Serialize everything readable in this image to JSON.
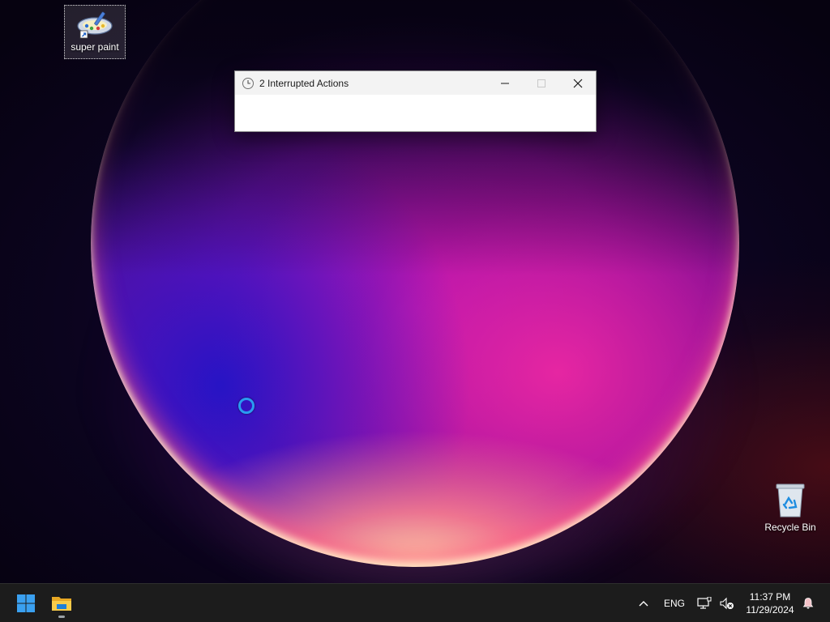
{
  "desktop": {
    "icons": [
      {
        "label": "super paint",
        "icon": "super-paint-icon",
        "selected": true
      },
      {
        "label": "Recycle Bin",
        "icon": "recycle-bin-icon",
        "selected": false
      }
    ]
  },
  "window": {
    "title": "2 Interrupted Actions",
    "icon": "clock-icon",
    "controls": {
      "minimize": "minimize-icon",
      "maximize": "maximize-icon",
      "close": "close-icon"
    }
  },
  "cursor": {
    "state": "busy"
  },
  "taskbar": {
    "pinned": [
      {
        "name": "start",
        "icon": "windows-logo-icon"
      },
      {
        "name": "file-explorer",
        "icon": "folder-icon",
        "running": true
      }
    ],
    "tray": {
      "overflow_icon": "chevron-up-icon",
      "language": "ENG",
      "network_icon": "network-icon",
      "volume_icon": "volume-muted-icon",
      "time": "11:37 PM",
      "date": "11/29/2024",
      "notifications_icon": "bell-icon"
    }
  },
  "colors": {
    "accent": "#2a9bf0",
    "taskbar": "#1c1c1c",
    "titlebar": "#f3f3f3"
  }
}
